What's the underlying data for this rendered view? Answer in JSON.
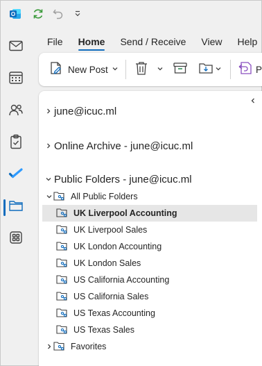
{
  "menu": {
    "tabs": [
      "File",
      "Home",
      "Send / Receive",
      "View",
      "Help"
    ],
    "active_tab": "Home"
  },
  "ribbon": {
    "new_post_label": "New Post",
    "cut_off_label": "P"
  },
  "folders": {
    "accounts": [
      {
        "label": "june@icuc.ml",
        "expanded": false
      },
      {
        "label": "Online Archive - june@icuc.ml",
        "expanded": false
      },
      {
        "label": "Public Folders - june@icuc.ml",
        "expanded": true
      }
    ],
    "all_public_folders": "All Public Folders",
    "items": [
      {
        "label": "UK Liverpool Accounting",
        "selected": true
      },
      {
        "label": "UK Liverpool Sales",
        "selected": false
      },
      {
        "label": "UK London Accounting",
        "selected": false
      },
      {
        "label": "UK London Sales",
        "selected": false
      },
      {
        "label": "US California Accounting",
        "selected": false
      },
      {
        "label": "US California Sales",
        "selected": false
      },
      {
        "label": "US Texas Accounting",
        "selected": false
      },
      {
        "label": "US Texas Sales",
        "selected": false
      }
    ],
    "favorites": "Favorites"
  },
  "colors": {
    "accent": "#0f6cbd",
    "outlook_blue": "#0f6cbd",
    "sync_green": "#3a9a3a",
    "todo_blue": "#1f6fd1",
    "selected_bg": "#e6e6e6",
    "post_purple": "#8a4fbf"
  },
  "icons": {
    "rail": [
      "mail-icon",
      "calendar-icon",
      "people-icon",
      "tasks-icon",
      "todo-icon",
      "folders-icon",
      "apps-icon"
    ]
  }
}
